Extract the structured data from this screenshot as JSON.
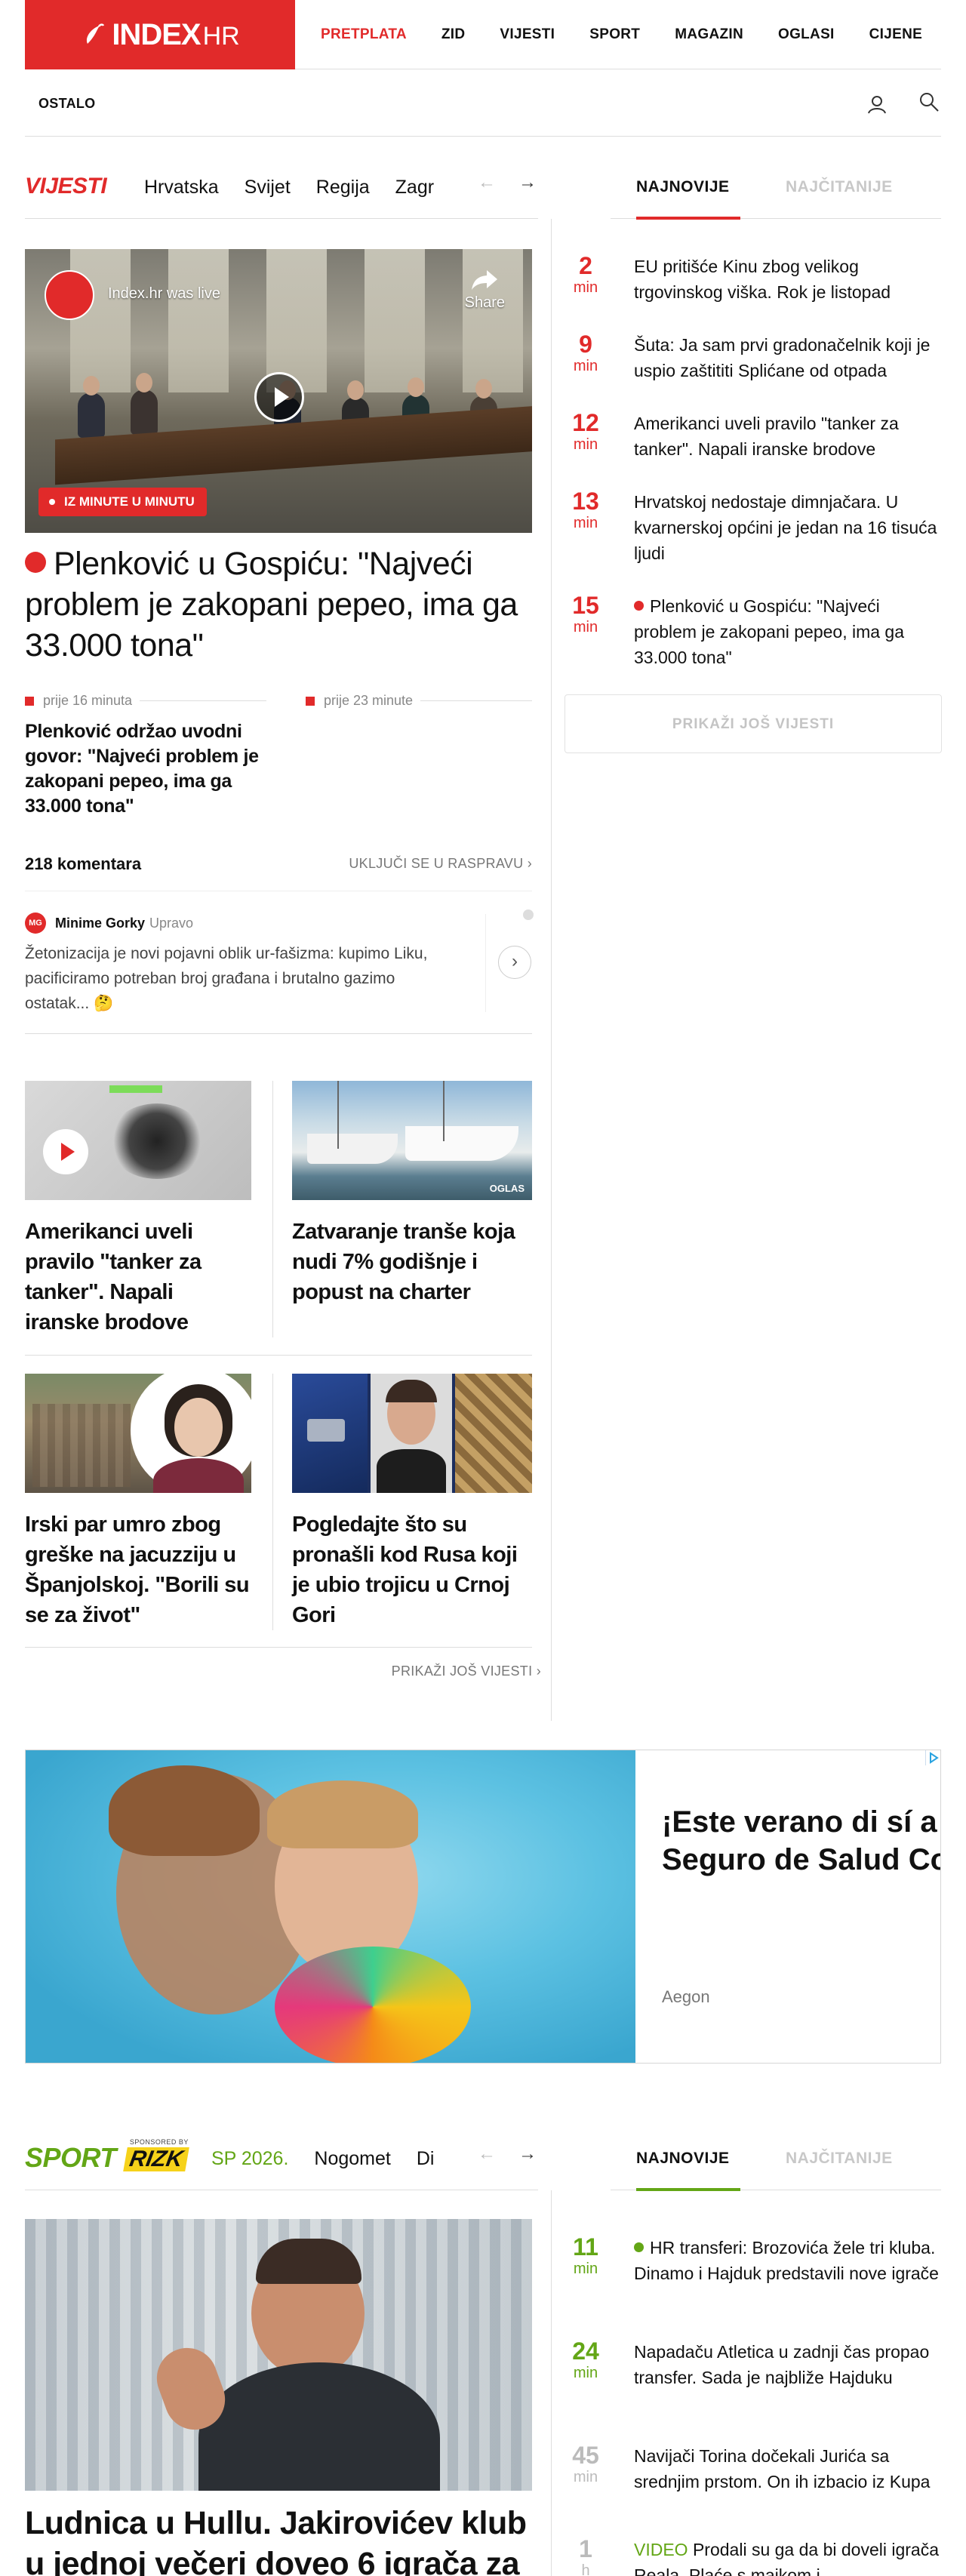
{
  "header": {
    "logo_text": "INDEX",
    "logo_suffix": "HR",
    "nav": [
      "PRETPLATA",
      "ZID",
      "VIJESTI",
      "SPORT",
      "MAGAZIN",
      "OGLASI",
      "CIJENE"
    ],
    "more": "OSTALO",
    "accent_color": "#e12a2a"
  },
  "vijesti": {
    "title": "VIJESTI",
    "categories": [
      "Hrvatska",
      "Svijet",
      "Regija",
      "Zagr"
    ],
    "tabs": [
      "NAJNOVIJE",
      "NAJČITANIJE"
    ],
    "video": {
      "channel": "Index.hr was live",
      "share": "Share",
      "badge": "IZ MINUTE U MINUTU"
    },
    "main_title": "Plenković u Gospiću: \"Najveći problem je zakopani pepeo, ima ga 33.000 tona\"",
    "subs": [
      {
        "time": "prije 16 minuta",
        "text": "Plenković održao uvodni govor: \"Najveći problem je zakopani pepeo, ima ga 33.000 tona\""
      },
      {
        "time": "prije 23 minute",
        "text": ""
      }
    ],
    "comments": {
      "count": "218 komentara",
      "join": "UKLJUČI SE U RASPRAVU ›",
      "items": [
        {
          "initials": "MG",
          "name": "Minime Gorky",
          "role": "Upravo",
          "body": "Žetonizacija je novi pojavni oblik ur-fašizma: kupimo Liku, pacificiramo potreban broj građana i brutalno gazimo ostatak... 🤔"
        }
      ]
    },
    "cards": [
      {
        "title": "Amerikanci uveli pravilo \"tanker za tanker\". Napali iranske brodove"
      },
      {
        "title": "Zatvaranje tranše koja nudi 7% godišnje i popust na charter",
        "tag": "OGLAS"
      },
      {
        "title": "Irski par umro zbog greške na jacuzziju u Španjolskoj. \"Borili su se za život\""
      },
      {
        "title": "Pogledajte što su pronašli kod Rusa koji je ubio trojicu u Crnoj Gori"
      }
    ],
    "more": "PRIKAŽI JOŠ VIJESTI ›",
    "latest": [
      {
        "num": "2",
        "unit": "min",
        "text": "EU pritišće Kinu zbog velikog trgovinskog viška. Rok je listopad"
      },
      {
        "num": "9",
        "unit": "min",
        "text": "Šuta: Ja sam prvi gradonačelnik koji je uspio zaštititi Splićane od otpada"
      },
      {
        "num": "12",
        "unit": "min",
        "text": "Amerikanci uveli pravilo \"tanker za tanker\". Napali iranske brodove"
      },
      {
        "num": "13",
        "unit": "min",
        "text": "Hrvatskoj nedostaje dimnjačara. U kvarnerskoj općini je jedan na 16 tisuća ljudi"
      },
      {
        "num": "15",
        "unit": "min",
        "text": "Plenković u Gospiću: \"Najveći problem je zakopani pepeo, ima ga 33.000 tona\""
      }
    ],
    "load_more": "PRIKAŽI JOŠ VIJESTI"
  },
  "ad": {
    "headline": "¡Este verano di sí a tu Seguro de Salud Completo",
    "headline_l1": "¡Este verano di sí a",
    "headline_l2": "Seguro de Salud Co",
    "brand": "Aegon"
  },
  "sport": {
    "title": "SPORT",
    "sponsored_by": "SPONSORED BY",
    "sponsor": "RIZK",
    "categories": [
      "SP 2026.",
      "Nogomet",
      "Di"
    ],
    "tabs": [
      "NAJNOVIJE",
      "NAJČITANIJE"
    ],
    "accent_color": "#63a616",
    "main_title": "Ludnica u Hullu. Jakirovićev klub u jednoj večeri doveo 6 igrača za",
    "latest": [
      {
        "num": "11",
        "unit": "min",
        "text": "HR transferi: Brozovića žele tri kluba. Dinamo i Hajduk predstavili nove igrače"
      },
      {
        "num": "24",
        "unit": "min",
        "text": "Napadaču Atletica u zadnji čas propao transfer. Sada je najbliže Hajduku"
      },
      {
        "num": "45",
        "unit": "min",
        "text": "Navijači Torina dočekali Jurića sa srednjim prstom. On ih izbacio iz Kupa"
      },
      {
        "num": "1",
        "unit": "h",
        "prefix": "VIDEO",
        "text": "Prodali su ga da bi doveli igrača Reala. Plaće s maikom i"
      }
    ]
  }
}
